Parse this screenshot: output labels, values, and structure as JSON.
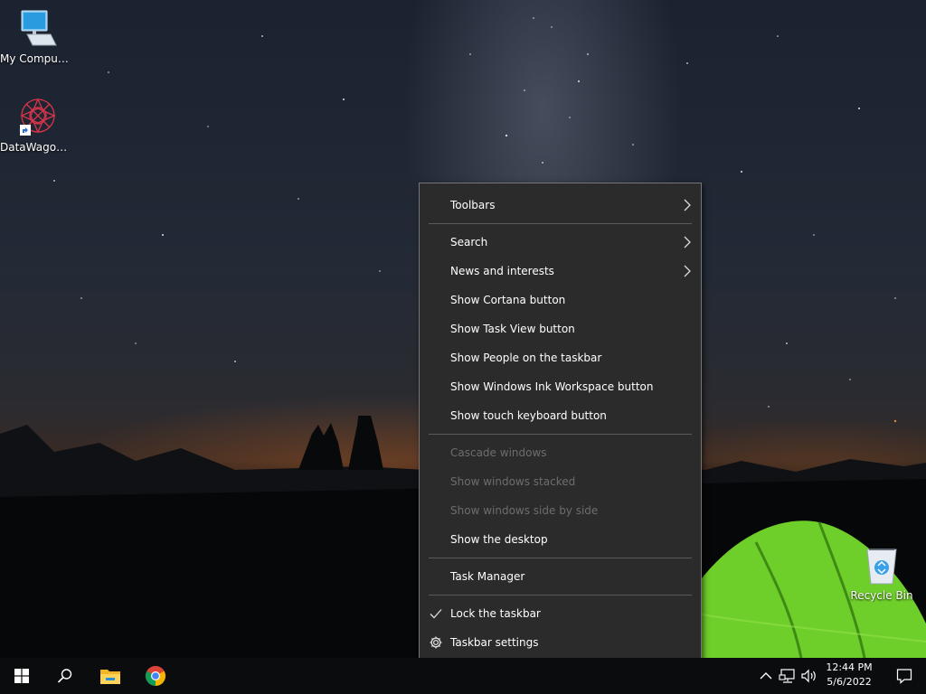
{
  "desktop": {
    "icons": [
      {
        "label": "My Computer",
        "icon": "computer-icon"
      },
      {
        "label": "DataWagon...",
        "icon": "datawagon-icon"
      },
      {
        "label": "Recycle Bin",
        "icon": "recycle-bin-icon"
      }
    ]
  },
  "context_menu": {
    "items": [
      {
        "label": "Toolbars",
        "submenu": true,
        "enabled": true
      },
      {
        "label": "Search",
        "submenu": true,
        "enabled": true
      },
      {
        "label": "News and interests",
        "submenu": true,
        "enabled": true
      },
      {
        "label": "Show Cortana button",
        "enabled": true
      },
      {
        "label": "Show Task View button",
        "enabled": true
      },
      {
        "label": "Show People on the taskbar",
        "enabled": true
      },
      {
        "label": "Show Windows Ink Workspace button",
        "enabled": true
      },
      {
        "label": "Show touch keyboard button",
        "enabled": true
      },
      {
        "label": "Cascade windows",
        "enabled": false
      },
      {
        "label": "Show windows stacked",
        "enabled": false
      },
      {
        "label": "Show windows side by side",
        "enabled": false
      },
      {
        "label": "Show the desktop",
        "enabled": true
      },
      {
        "label": "Task Manager",
        "enabled": true
      },
      {
        "label": "Lock the taskbar",
        "enabled": true,
        "checked": true,
        "icon": "checkmark-icon"
      },
      {
        "label": "Taskbar settings",
        "enabled": true,
        "icon": "gear-icon"
      }
    ]
  },
  "taskbar": {
    "pinned": [
      "start-icon",
      "search-icon",
      "file-explorer-icon",
      "chrome-icon"
    ],
    "tray": [
      "chevron-up-icon",
      "network-icon",
      "volume-icon"
    ],
    "time": "12:44 PM",
    "date": "5/6/2022"
  },
  "colors": {
    "menu_bg": "#2b2b2b",
    "menu_border": "#777777",
    "menu_text": "#ffffff",
    "menu_disabled": "#6d6d6d",
    "taskbar_bg": "#0b0c0e",
    "windows_blue": "#2d8cd8"
  }
}
